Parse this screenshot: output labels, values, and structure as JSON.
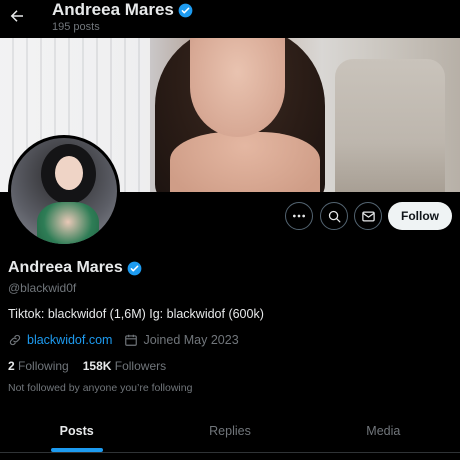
{
  "header": {
    "name": "Andreea Mares",
    "posts_count": "195 posts"
  },
  "profile": {
    "name": "Andreea Mares",
    "handle": "@blackwid0f",
    "bio": "Tiktok: blackwidof (1,6M) Ig: blackwidof (600k)",
    "website": "blackwidof.com",
    "joined": "Joined May 2023",
    "following_count": "2",
    "following_label": "Following",
    "followers_count": "158K",
    "followers_label": "Followers",
    "not_followed_text": "Not followed by anyone you’re following"
  },
  "actions": {
    "follow_label": "Follow"
  },
  "tabs": [
    {
      "label": "Posts",
      "active": true
    },
    {
      "label": "Replies",
      "active": false
    },
    {
      "label": "Media",
      "active": false
    }
  ],
  "icons": {
    "back": "back-arrow-icon",
    "verified": "verified-badge-icon",
    "more": "more-icon",
    "search": "search-icon",
    "message": "message-icon",
    "link": "link-icon",
    "calendar": "calendar-icon"
  },
  "colors": {
    "accent": "#1d9bf0",
    "background": "#000000",
    "muted_text": "#71767b",
    "follow_button": "#eff3f4"
  }
}
